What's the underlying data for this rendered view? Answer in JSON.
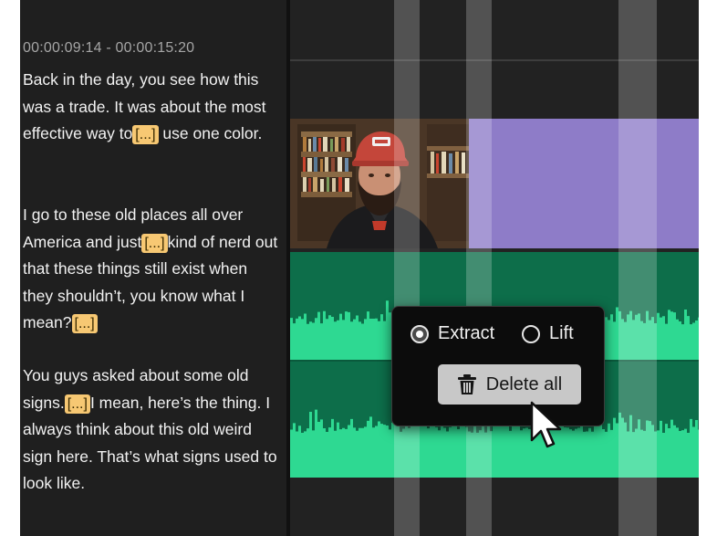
{
  "transcript": {
    "timecode": "00:00:09:14 - 00:00:15:20",
    "paragraphs": [
      {
        "parts": [
          "Back in the day, you see how this was a trade.  It was about the most effective way to",
          "use one color."
        ]
      },
      {
        "parts": [
          "I go to these old places all over America and just",
          "kind of nerd out that these things still exist when they shouldn’t, you know what I mean?",
          ""
        ]
      },
      {
        "parts": [
          "You guys asked about some old signs.",
          "I mean, here’s the thing. I always think about this old weird sign here. That’s what signs used to look like."
        ]
      }
    ],
    "gap_marker": "[...]"
  },
  "popup": {
    "options": [
      {
        "label": "Extract",
        "selected": true
      },
      {
        "label": "Lift",
        "selected": false
      }
    ],
    "delete_label": "Delete all"
  },
  "colors": {
    "gap_highlight": "#f7c873",
    "video_clip": "#8e7cc8",
    "audio_dark": "#0d6e4a",
    "audio_wave": "#2ed992"
  },
  "icons": {
    "delete": "trash-icon",
    "pointer": "cursor-arrow-icon"
  }
}
